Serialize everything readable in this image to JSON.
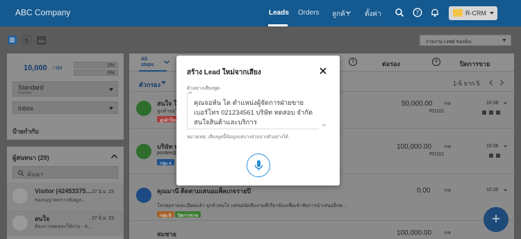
{
  "header": {
    "brand": "ABC Company",
    "nav": [
      "Leads",
      "Orders",
      "ลูกค้า",
      "ตั้งค่า"
    ],
    "crm_label": "R-CRM"
  },
  "subbar": {
    "report_select": "รายงาน Lead ของฉัน"
  },
  "left_panel": {
    "amount": "10,000",
    "amount_unit": "/ 9M",
    "bar1": "0%",
    "bar2": "0%",
    "pipeline_value": "Standard",
    "pipeline_caption": "Pipeline",
    "inbox_value": "Inbox",
    "tags_title": "ป้ายกำกับ",
    "customers_title": "ผู้สนทนา (29)",
    "search_placeholder": "ค้นหา",
    "chats": [
      {
        "name": "Visitor (42453375...",
        "time": "27 มิ.ย. 23",
        "preview": "ขออนุญาตทราบข้อมูล..."
      },
      {
        "name": "สนใจ",
        "time": "27 มิ.ย. 23",
        "preview": "ต้องการทดลองใช้งาน - A..."
      }
    ]
  },
  "board": {
    "tab_all": "All steps",
    "step3_num": "3",
    "step3_label": "ต่อรอง",
    "step4_num": "4",
    "step4_label": "ปิดการขาย",
    "sort_label": "ตัวกรอง",
    "pagination": "1-5 จาก 5",
    "rows": [
      {
        "title": "สนใจ ใช้ง...",
        "sub": "ลูกค้าขอใบ...",
        "amount": "50,000.00",
        "unit": "THB",
        "code": "PD101",
        "time": "10:38"
      },
      {
        "title": "บริษัท ทดสอบ...",
        "sub": "pordee@...",
        "amount": "100,000.00",
        "unit": "THB",
        "code": "PD101",
        "time": "10:36"
      },
      {
        "title": "คุณมานี ติดตามเสนอแพ็คเกจรายปี",
        "sub": "โทรคุยรายละเอียดแล้ว ลูกค้าสนใจ แต่ขอนัดทีมงานที่เกี่ยวข้องเพื่อเข้าฟังการนำเสนออีกค...",
        "amount": "0.00",
        "unit": "THB",
        "code": "",
        "time": "10:35"
      },
      {
        "title": "สมชาย",
        "sub": "",
        "amount": "100,000.00",
        "unit": "THB",
        "code": "",
        "time": "พฤ, 8 มิ.ย. 23"
      }
    ],
    "row_tags": [
      "ลูกค้าใหม่",
      "กลุ่ม A",
      "กลุ่ม B",
      "ปิดการขาย"
    ]
  },
  "modal": {
    "title": "สร้าง Lead ใหม่จากเสียง",
    "example_label": "ตัวอย่างเสียงพูด",
    "example_text": "คุณจอห์น โด ตำแหน่งผู้จัดการฝ่ายขาย เบอร์โทร 021234561 บริษัท ทดสอบ จำกัด สนใจสินค้าและบริการ",
    "note": "หมายเหตุ: เสียงพูดนี้ข้อมูลแค่บางส่วนจากตัวอย่างได้"
  },
  "colors": {
    "nav_bg": "#14598f",
    "accent": "#2a8fd8",
    "fab": "#1d4a78"
  }
}
